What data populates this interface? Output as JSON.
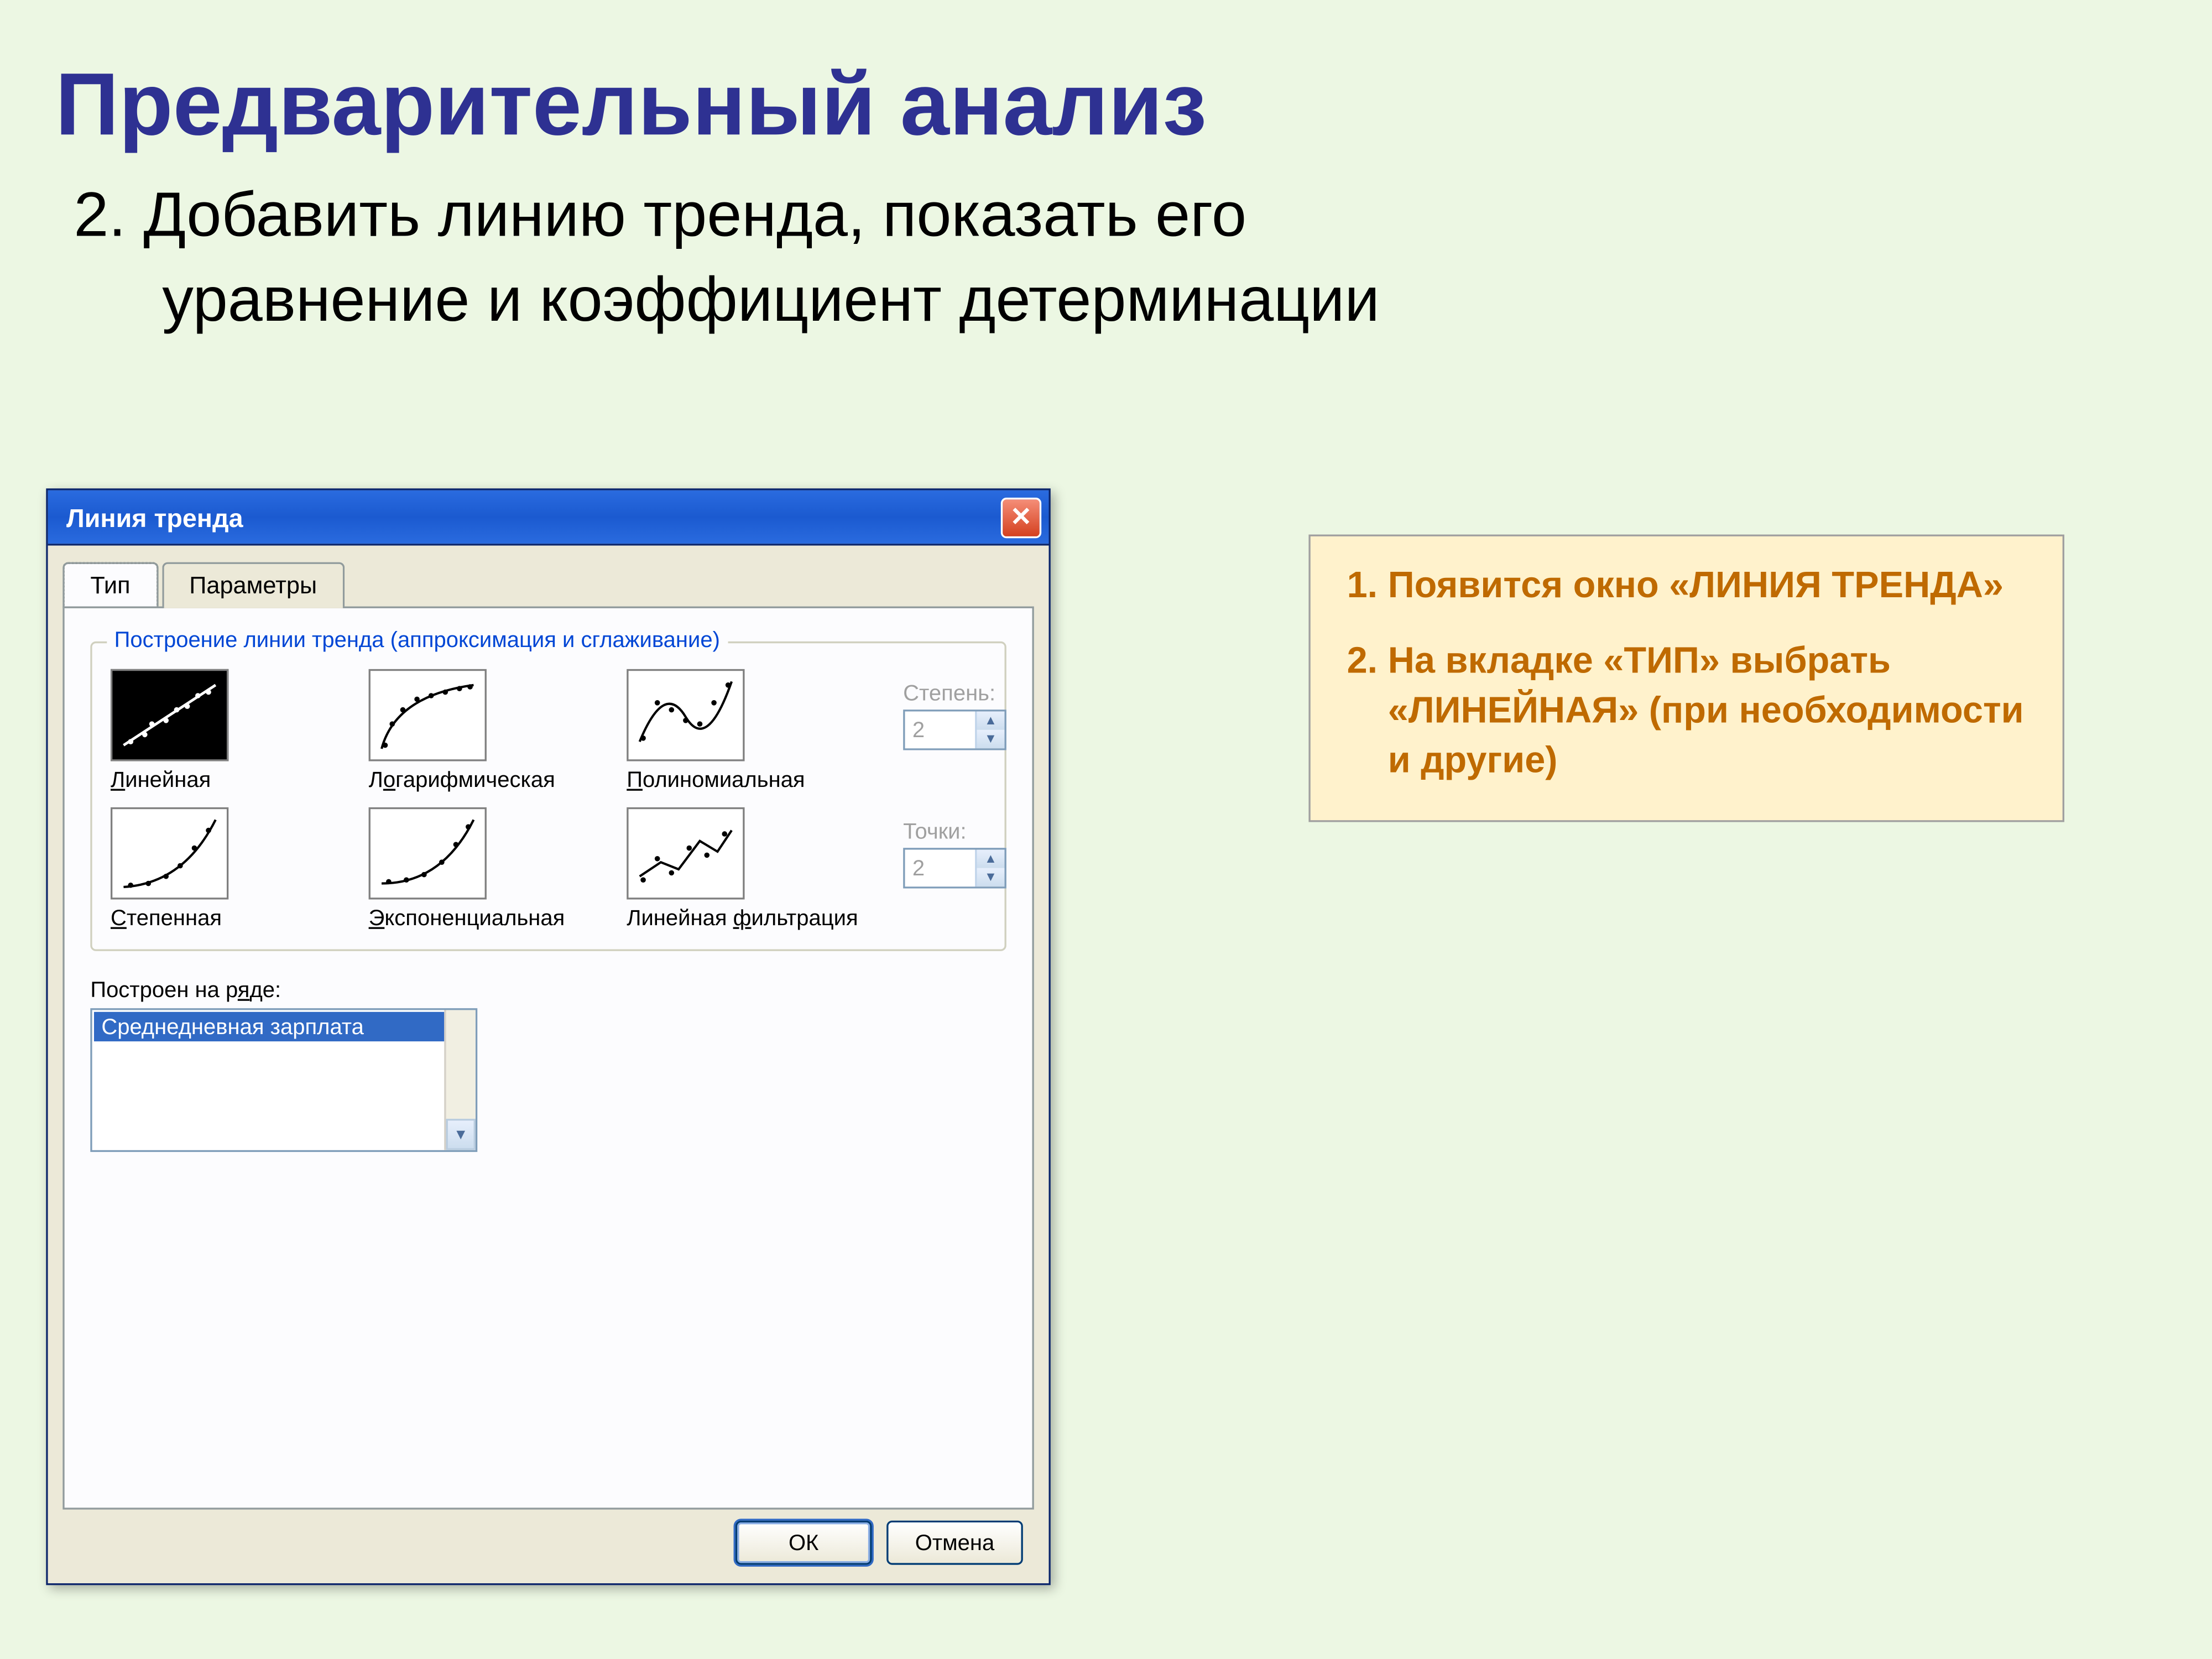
{
  "slide": {
    "title": "Предварительный анализ",
    "subtitle_line1": "2. Добавить линию тренда, показать его",
    "subtitle_line2": "уравнение и коэффициент детерминации"
  },
  "dialog": {
    "title": "Линия тренда",
    "tabs": {
      "type": "Тип",
      "params": "Параметры"
    },
    "group_title": "Построение линии тренда (аппроксимация и сглаживание)",
    "thumbs": {
      "linear": "Линейная",
      "log": "Логарифмическая",
      "poly": "Полиномиальная",
      "power": "Степенная",
      "exp": "Экспоненциальная",
      "mavg": "Линейная фильтрация"
    },
    "degree_label": "Степень:",
    "degree_value": "2",
    "points_label": "Точки:",
    "points_value": "2",
    "series_label": "Построен на ряде:",
    "series_item": "Среднедневная зарплата",
    "ok": "ОК",
    "cancel": "Отмена"
  },
  "notes": {
    "item1": "Появится окно «ЛИНИЯ ТРЕНДА»",
    "item2": "На вкладке «ТИП» выбрать «ЛИНЕЙНАЯ» (при необходимости и другие)"
  }
}
